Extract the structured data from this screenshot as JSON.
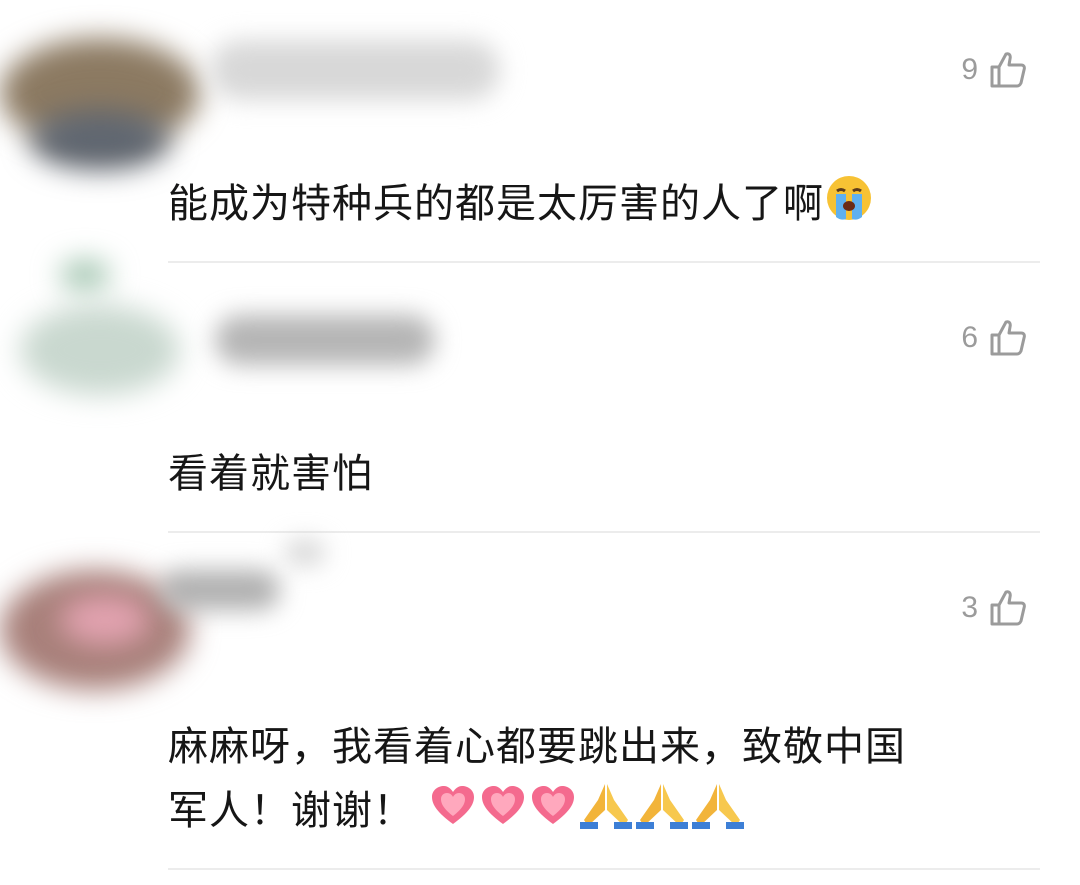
{
  "comments": [
    {
      "likes": "9",
      "text": "能成为特种兵的都是太厉害的人了啊",
      "emoji": [
        "loudly-crying-face"
      ]
    },
    {
      "likes": "6",
      "text": "看着就害怕",
      "emoji": []
    },
    {
      "likes": "3",
      "text_line1": "麻麻呀，我看着心都要跳出来，致敬中国",
      "text_line2": "军人！谢谢！",
      "emoji": [
        "growing-heart",
        "growing-heart",
        "growing-heart",
        "folded-hands",
        "folded-hands",
        "folded-hands"
      ]
    }
  ],
  "colors": {
    "like_gray": "#9b9b9b",
    "text": "#161616",
    "divider": "#ececec"
  }
}
